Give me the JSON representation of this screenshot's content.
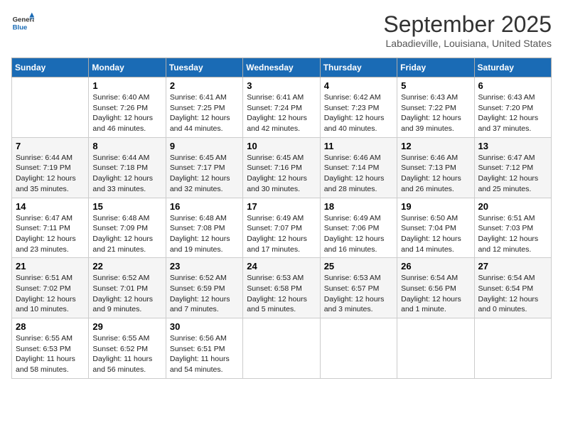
{
  "header": {
    "logo_general": "General",
    "logo_blue": "Blue",
    "month_title": "September 2025",
    "subtitle": "Labadieville, Louisiana, United States"
  },
  "weekdays": [
    "Sunday",
    "Monday",
    "Tuesday",
    "Wednesday",
    "Thursday",
    "Friday",
    "Saturday"
  ],
  "weeks": [
    [
      {
        "day": "",
        "sunrise": "",
        "sunset": "",
        "daylight": ""
      },
      {
        "day": "1",
        "sunrise": "Sunrise: 6:40 AM",
        "sunset": "Sunset: 7:26 PM",
        "daylight": "Daylight: 12 hours and 46 minutes."
      },
      {
        "day": "2",
        "sunrise": "Sunrise: 6:41 AM",
        "sunset": "Sunset: 7:25 PM",
        "daylight": "Daylight: 12 hours and 44 minutes."
      },
      {
        "day": "3",
        "sunrise": "Sunrise: 6:41 AM",
        "sunset": "Sunset: 7:24 PM",
        "daylight": "Daylight: 12 hours and 42 minutes."
      },
      {
        "day": "4",
        "sunrise": "Sunrise: 6:42 AM",
        "sunset": "Sunset: 7:23 PM",
        "daylight": "Daylight: 12 hours and 40 minutes."
      },
      {
        "day": "5",
        "sunrise": "Sunrise: 6:43 AM",
        "sunset": "Sunset: 7:22 PM",
        "daylight": "Daylight: 12 hours and 39 minutes."
      },
      {
        "day": "6",
        "sunrise": "Sunrise: 6:43 AM",
        "sunset": "Sunset: 7:20 PM",
        "daylight": "Daylight: 12 hours and 37 minutes."
      }
    ],
    [
      {
        "day": "7",
        "sunrise": "Sunrise: 6:44 AM",
        "sunset": "Sunset: 7:19 PM",
        "daylight": "Daylight: 12 hours and 35 minutes."
      },
      {
        "day": "8",
        "sunrise": "Sunrise: 6:44 AM",
        "sunset": "Sunset: 7:18 PM",
        "daylight": "Daylight: 12 hours and 33 minutes."
      },
      {
        "day": "9",
        "sunrise": "Sunrise: 6:45 AM",
        "sunset": "Sunset: 7:17 PM",
        "daylight": "Daylight: 12 hours and 32 minutes."
      },
      {
        "day": "10",
        "sunrise": "Sunrise: 6:45 AM",
        "sunset": "Sunset: 7:16 PM",
        "daylight": "Daylight: 12 hours and 30 minutes."
      },
      {
        "day": "11",
        "sunrise": "Sunrise: 6:46 AM",
        "sunset": "Sunset: 7:14 PM",
        "daylight": "Daylight: 12 hours and 28 minutes."
      },
      {
        "day": "12",
        "sunrise": "Sunrise: 6:46 AM",
        "sunset": "Sunset: 7:13 PM",
        "daylight": "Daylight: 12 hours and 26 minutes."
      },
      {
        "day": "13",
        "sunrise": "Sunrise: 6:47 AM",
        "sunset": "Sunset: 7:12 PM",
        "daylight": "Daylight: 12 hours and 25 minutes."
      }
    ],
    [
      {
        "day": "14",
        "sunrise": "Sunrise: 6:47 AM",
        "sunset": "Sunset: 7:11 PM",
        "daylight": "Daylight: 12 hours and 23 minutes."
      },
      {
        "day": "15",
        "sunrise": "Sunrise: 6:48 AM",
        "sunset": "Sunset: 7:09 PM",
        "daylight": "Daylight: 12 hours and 21 minutes."
      },
      {
        "day": "16",
        "sunrise": "Sunrise: 6:48 AM",
        "sunset": "Sunset: 7:08 PM",
        "daylight": "Daylight: 12 hours and 19 minutes."
      },
      {
        "day": "17",
        "sunrise": "Sunrise: 6:49 AM",
        "sunset": "Sunset: 7:07 PM",
        "daylight": "Daylight: 12 hours and 17 minutes."
      },
      {
        "day": "18",
        "sunrise": "Sunrise: 6:49 AM",
        "sunset": "Sunset: 7:06 PM",
        "daylight": "Daylight: 12 hours and 16 minutes."
      },
      {
        "day": "19",
        "sunrise": "Sunrise: 6:50 AM",
        "sunset": "Sunset: 7:04 PM",
        "daylight": "Daylight: 12 hours and 14 minutes."
      },
      {
        "day": "20",
        "sunrise": "Sunrise: 6:51 AM",
        "sunset": "Sunset: 7:03 PM",
        "daylight": "Daylight: 12 hours and 12 minutes."
      }
    ],
    [
      {
        "day": "21",
        "sunrise": "Sunrise: 6:51 AM",
        "sunset": "Sunset: 7:02 PM",
        "daylight": "Daylight: 12 hours and 10 minutes."
      },
      {
        "day": "22",
        "sunrise": "Sunrise: 6:52 AM",
        "sunset": "Sunset: 7:01 PM",
        "daylight": "Daylight: 12 hours and 9 minutes."
      },
      {
        "day": "23",
        "sunrise": "Sunrise: 6:52 AM",
        "sunset": "Sunset: 6:59 PM",
        "daylight": "Daylight: 12 hours and 7 minutes."
      },
      {
        "day": "24",
        "sunrise": "Sunrise: 6:53 AM",
        "sunset": "Sunset: 6:58 PM",
        "daylight": "Daylight: 12 hours and 5 minutes."
      },
      {
        "day": "25",
        "sunrise": "Sunrise: 6:53 AM",
        "sunset": "Sunset: 6:57 PM",
        "daylight": "Daylight: 12 hours and 3 minutes."
      },
      {
        "day": "26",
        "sunrise": "Sunrise: 6:54 AM",
        "sunset": "Sunset: 6:56 PM",
        "daylight": "Daylight: 12 hours and 1 minute."
      },
      {
        "day": "27",
        "sunrise": "Sunrise: 6:54 AM",
        "sunset": "Sunset: 6:54 PM",
        "daylight": "Daylight: 12 hours and 0 minutes."
      }
    ],
    [
      {
        "day": "28",
        "sunrise": "Sunrise: 6:55 AM",
        "sunset": "Sunset: 6:53 PM",
        "daylight": "Daylight: 11 hours and 58 minutes."
      },
      {
        "day": "29",
        "sunrise": "Sunrise: 6:55 AM",
        "sunset": "Sunset: 6:52 PM",
        "daylight": "Daylight: 11 hours and 56 minutes."
      },
      {
        "day": "30",
        "sunrise": "Sunrise: 6:56 AM",
        "sunset": "Sunset: 6:51 PM",
        "daylight": "Daylight: 11 hours and 54 minutes."
      },
      {
        "day": "",
        "sunrise": "",
        "sunset": "",
        "daylight": ""
      },
      {
        "day": "",
        "sunrise": "",
        "sunset": "",
        "daylight": ""
      },
      {
        "day": "",
        "sunrise": "",
        "sunset": "",
        "daylight": ""
      },
      {
        "day": "",
        "sunrise": "",
        "sunset": "",
        "daylight": ""
      }
    ]
  ]
}
